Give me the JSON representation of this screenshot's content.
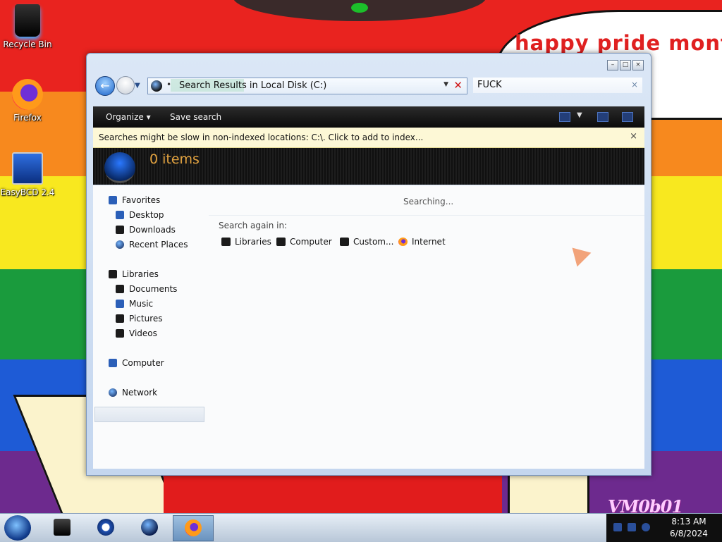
{
  "desktop": {
    "wallpaper_text": "happy pride month",
    "watermark": "VM0b01",
    "icons": [
      {
        "label": "Recycle Bin",
        "icon": "recycle-bin-icon"
      },
      {
        "label": "Firefox",
        "icon": "firefox-icon"
      },
      {
        "label": "EasyBCD 2.4",
        "icon": "easybcd-icon"
      }
    ]
  },
  "window": {
    "caption_buttons": [
      "minimize",
      "maximize",
      "close"
    ],
    "address": {
      "path": "Search Results in Local Disk (C:)",
      "icon": "search-results-icon"
    },
    "search": {
      "value": "FUCK",
      "clear_glyph": "×"
    },
    "toolbar": {
      "organize": "Organize",
      "save_search": "Save search"
    },
    "infobar": {
      "text": "Searches might be slow in non-indexed locations: C:\\. Click to add to index...",
      "close_glyph": "×"
    },
    "header": {
      "count": "0 items"
    },
    "nav": {
      "favorites": {
        "label": "Favorites",
        "items": [
          "Desktop",
          "Downloads",
          "Recent Places"
        ]
      },
      "libraries": {
        "label": "Libraries",
        "items": [
          "Documents",
          "Music",
          "Pictures",
          "Videos"
        ]
      },
      "computer": "Computer",
      "network": "Network"
    },
    "main": {
      "status": "Searching...",
      "search_again_label": "Search again in:",
      "locations": [
        "Libraries",
        "Computer",
        "Custom...",
        "Internet"
      ]
    }
  },
  "taskbar": {
    "buttons": [
      "explorer",
      "media-player",
      "ie",
      "firefox"
    ],
    "active": "firefox",
    "clock": {
      "time": "8:13 AM",
      "date": "6/8/2024"
    }
  },
  "colors": {
    "accent_header_text": "#e3a340",
    "pride_text": "#e02020"
  }
}
